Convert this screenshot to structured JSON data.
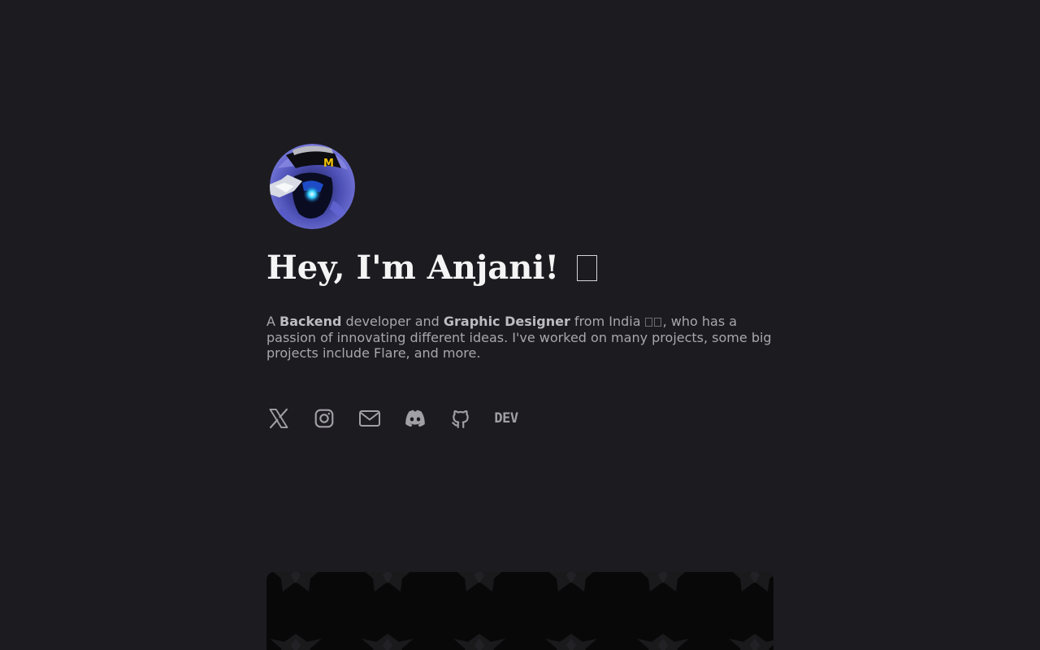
{
  "hero": {
    "headline": "Hey, I'm Anjani!",
    "bio": {
      "prefix": "A ",
      "role1": "Backend",
      "middle1": " developer and ",
      "role2": "Graphic Designer",
      "middle2": " from India ",
      "suffix": ", who has a passion of innovating different ideas. I've worked on many projects, some big projects include Flare, and more."
    }
  },
  "socials": [
    {
      "icon": "x-icon"
    },
    {
      "icon": "instagram-icon"
    },
    {
      "icon": "mail-icon"
    },
    {
      "icon": "discord-icon"
    },
    {
      "icon": "github-icon"
    },
    {
      "icon": "dev-icon",
      "text": "DEV"
    }
  ],
  "colors": {
    "background": "#1c1b20",
    "text": "#a8a7ac",
    "heading": "#f4f4f4",
    "icon": "#a1a0a5",
    "card": "#080808"
  }
}
